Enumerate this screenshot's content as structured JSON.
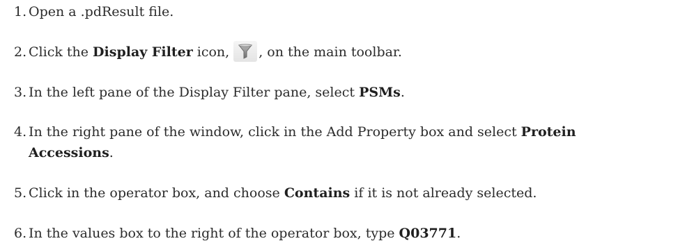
{
  "steps": [
    {
      "number": "1.",
      "text": "Open a .pdResult file."
    },
    {
      "number": "2.",
      "pre": "Click the ",
      "bold": "Display Filter",
      "mid": " icon,",
      "icon": "funnel-filter-icon",
      "post": ", on the main toolbar."
    },
    {
      "number": "3.",
      "pre": "In the left pane of the Display Filter pane, select ",
      "bold": "PSMs",
      "post": "."
    },
    {
      "number": "4.",
      "pre": "In the right pane of the window, click in the Add Property box and select ",
      "bold": "Protein",
      "bold2": "Accessions",
      "post": "."
    },
    {
      "number": "5.",
      "pre": "Click in the operator box, and choose ",
      "bold": "Contains",
      "post": " if it is not already selected."
    },
    {
      "number": "6.",
      "pre": "In the values box to the right of the operator box, type ",
      "bold": "Q03771",
      "post": "."
    }
  ],
  "colors": {
    "text": "#2b2b2b",
    "icon_funnel": "#8a8a8a",
    "icon_tile": "#ececec"
  }
}
